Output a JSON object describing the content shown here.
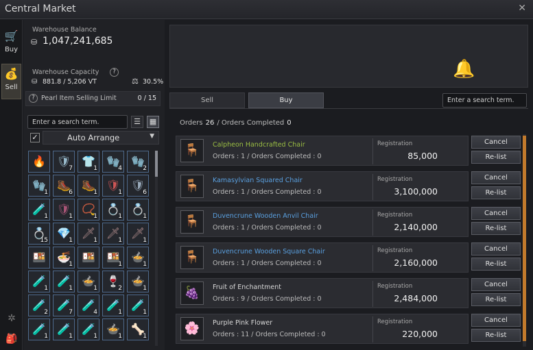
{
  "window": {
    "title": "Central Market",
    "close": "✕"
  },
  "rail": {
    "buy_label": "Buy",
    "sell_label": "Sell"
  },
  "warehouse": {
    "balance_label": "Warehouse Balance",
    "balance": "1,047,241,685",
    "capacity_label": "Warehouse Capacity",
    "capacity": "881.8 / 5,206 VT",
    "capacity_pct": "30.5%"
  },
  "pearl_limit": {
    "label": "Pearl Item Selling Limit",
    "value": "0 / 15"
  },
  "inventory": {
    "search_placeholder": "Enter a search term.",
    "arrange_label": "Auto Arrange",
    "slots": [
      {
        "g": "🔥",
        "c": "#e33",
        "n": ""
      },
      {
        "g": "🛡",
        "c": "#9bc",
        "n": "7"
      },
      {
        "g": "👕",
        "c": "#9b8",
        "n": "1"
      },
      {
        "g": "🧤",
        "c": "#c44",
        "n": "4"
      },
      {
        "g": "🧤",
        "c": "#9ab",
        "n": "2"
      },
      {
        "g": "🧤",
        "c": "#c93",
        "n": "1"
      },
      {
        "g": "🥾",
        "c": "#8ab",
        "n": "6"
      },
      {
        "g": "🥾",
        "c": "#a76",
        "n": "1"
      },
      {
        "g": "🛡",
        "c": "#c55",
        "n": "1"
      },
      {
        "g": "🛡",
        "c": "#9ab",
        "n": "6"
      },
      {
        "g": "🧪",
        "c": "#7a4",
        "n": "1"
      },
      {
        "g": "🛡",
        "c": "#a57",
        "n": "1"
      },
      {
        "g": "📿",
        "c": "#ccc",
        "n": "1"
      },
      {
        "g": "💍",
        "c": "#db4",
        "n": "1"
      },
      {
        "g": "💍",
        "c": "#c83",
        "n": "1"
      },
      {
        "g": "💍",
        "c": "#c33",
        "n": "15"
      },
      {
        "g": "💎",
        "c": "#48c",
        "n": "1"
      },
      {
        "g": "🗡",
        "c": "#a88",
        "n": "1"
      },
      {
        "g": "🗡",
        "c": "#a88",
        "n": "1"
      },
      {
        "g": "🗡",
        "c": "#a88",
        "n": "1"
      },
      {
        "g": "🍱",
        "c": "#d84",
        "n": ""
      },
      {
        "g": "🍜",
        "c": "#c93",
        "n": "1"
      },
      {
        "g": "🍱",
        "c": "#c84",
        "n": ""
      },
      {
        "g": "🍱",
        "c": "#c63",
        "n": "1"
      },
      {
        "g": "🍲",
        "c": "#7ac",
        "n": "1"
      },
      {
        "g": "🧪",
        "c": "#6c4",
        "n": "1"
      },
      {
        "g": "🧪",
        "c": "#c6c",
        "n": "1"
      },
      {
        "g": "🍲",
        "c": "#cb4",
        "n": "1"
      },
      {
        "g": "🍷",
        "c": "#c44",
        "n": "2"
      },
      {
        "g": "🍲",
        "c": "#996",
        "n": "1"
      },
      {
        "g": "🧪",
        "c": "#c5c",
        "n": "2"
      },
      {
        "g": "🧪",
        "c": "#a4c",
        "n": "7"
      },
      {
        "g": "🧪",
        "c": "#c84",
        "n": "4"
      },
      {
        "g": "🧪",
        "c": "#a4c",
        "n": "1"
      },
      {
        "g": "🧪",
        "c": "#c8c",
        "n": "1"
      },
      {
        "g": "🧪",
        "c": "#db4",
        "n": "1"
      },
      {
        "g": "🧪",
        "c": "#db4",
        "n": "1"
      },
      {
        "g": "🧪",
        "c": "#db4",
        "n": "1"
      },
      {
        "g": "🍲",
        "c": "#dc9",
        "n": "1"
      },
      {
        "g": "🦴",
        "c": "#b65",
        "n": "1"
      }
    ]
  },
  "tabs": {
    "sell": "Sell",
    "buy": "Buy",
    "search_placeholder": "Enter a search term."
  },
  "summary": {
    "orders_label": "Orders",
    "orders": "26",
    "completed_label": "/ Orders Completed",
    "completed": "0"
  },
  "orders": [
    {
      "name": "Calpheon Handcrafted Chair",
      "color": "#9bbf43",
      "counts": "Orders : 1 / Orders Completed : 0",
      "reg_label": "Registration",
      "price": "85,000",
      "icon": "🪑",
      "icon_color": "#c0523c"
    },
    {
      "name": "Kamasylvian Squared Chair",
      "color": "#5aa0e0",
      "counts": "Orders : 1 / Orders Completed : 0",
      "reg_label": "Registration",
      "price": "3,100,000",
      "icon": "🪑",
      "icon_color": "#e8dcc0"
    },
    {
      "name": "Duvencrune Wooden Anvil Chair",
      "color": "#5aa0e0",
      "counts": "Orders : 1 / Orders Completed : 0",
      "reg_label": "Registration",
      "price": "2,140,000",
      "icon": "🪑",
      "icon_color": "#a67c52"
    },
    {
      "name": "Duvencrune Wooden Square Chair",
      "color": "#5aa0e0",
      "counts": "Orders : 1 / Orders Completed : 0",
      "reg_label": "Registration",
      "price": "2,160,000",
      "icon": "🪑",
      "icon_color": "#a67c52"
    },
    {
      "name": "Fruit of Enchantment",
      "color": "#d8d8d8",
      "counts": "Orders : 9 / Orders Completed : 0",
      "reg_label": "Registration",
      "price": "2,484,000",
      "icon": "🍇",
      "icon_color": "#a04cc0"
    },
    {
      "name": "Purple Pink Flower",
      "color": "#d8d8d8",
      "counts": "Orders : 11 / Orders Completed : 0",
      "reg_label": "Registration",
      "price": "220,000",
      "icon": "🌸",
      "icon_color": "#d060c0"
    }
  ],
  "buttons": {
    "cancel": "Cancel",
    "relist": "Re-list"
  }
}
